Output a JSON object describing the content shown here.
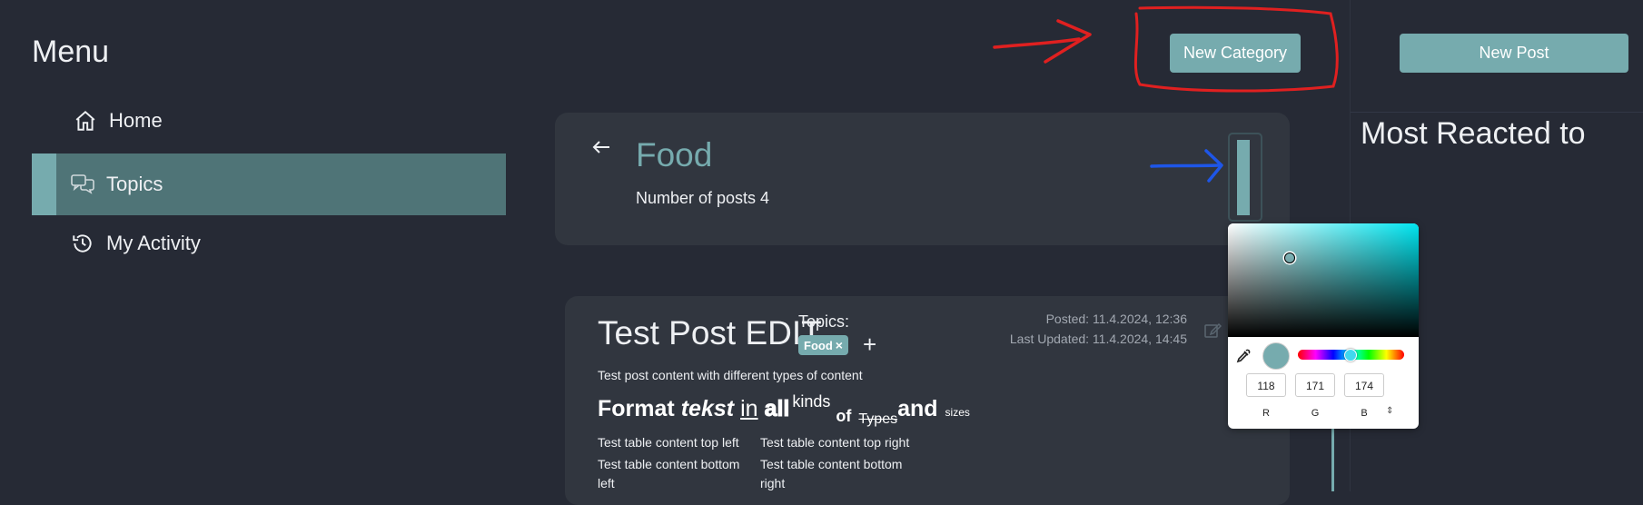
{
  "sidebar": {
    "title": "Menu",
    "items": [
      {
        "label": "Home",
        "icon": "home-icon"
      },
      {
        "label": "Topics",
        "icon": "chat-bubbles-icon",
        "active": true
      },
      {
        "label": "My Activity",
        "icon": "history-icon"
      }
    ]
  },
  "header": {
    "new_category_label": "New Category",
    "new_post_label": "New Post"
  },
  "category": {
    "title": "Food",
    "post_count_text": "Number of posts 4",
    "color": "#76abae"
  },
  "right_panel": {
    "heading": "Most Reacted to"
  },
  "post": {
    "title": "Test Post EDIT",
    "topics_label": "Topics:",
    "tag": "Food",
    "tag_close": "×",
    "add_topic": "+",
    "posted": "Posted: 11.4.2024, 12:36",
    "updated": "Last Updated: 11.4.2024, 14:45",
    "content_line": "Test post content with different types of content",
    "format": {
      "w1": "Format",
      "w2": "tekst",
      "w3": "in",
      "w4": "all",
      "w5": "kinds",
      "w6": "of",
      "w7": "Types",
      "w8": "and",
      "w9": "sizes"
    },
    "table": {
      "top_left": "Test table content top left",
      "top_right": "Test table content top right",
      "bottom_left": "Test table content bottom left",
      "bottom_right": "Test table content bottom right"
    }
  },
  "color_picker": {
    "r": "118",
    "g": "171",
    "b": "174",
    "r_label": "R",
    "g_label": "G",
    "b_label": "B",
    "mode_toggle": "⇕"
  },
  "colors": {
    "accent": "#76abae",
    "background": "#262a35",
    "card": "#31363f"
  }
}
